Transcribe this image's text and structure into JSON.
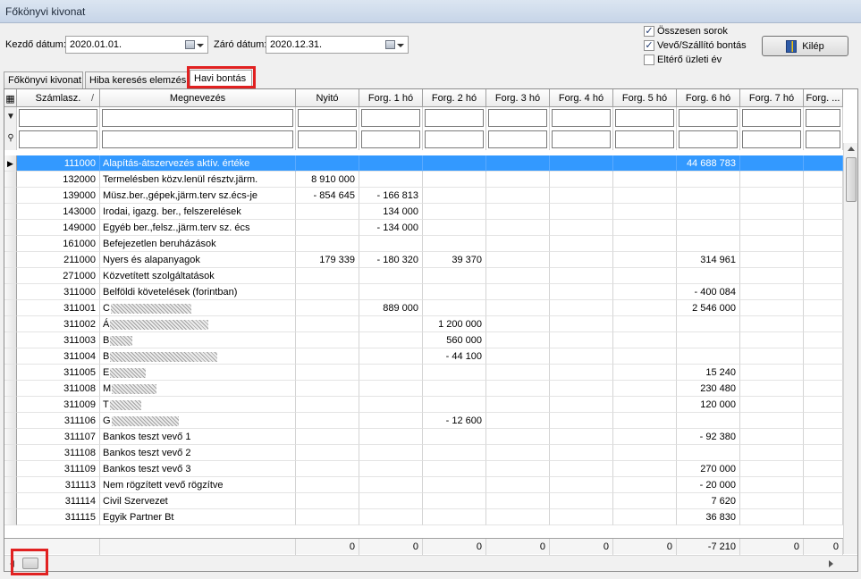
{
  "window": {
    "title": "Főkönyvi kivonat"
  },
  "filters": {
    "start_label": "Kezdő dátum:",
    "start_value": "2020.01.01.",
    "end_label": "Záró dátum:",
    "end_value": "2020.12.31."
  },
  "options": {
    "total_rows": {
      "label": "Összesen sorok",
      "checked": true
    },
    "partner_split": {
      "label": "Vevő/Szállító bontás",
      "checked": true
    },
    "diff_year": {
      "label": "Eltérő üzleti év",
      "checked": false
    }
  },
  "exit_button": {
    "label": "Kilép",
    "icon": "door-exit-icon"
  },
  "tabs": [
    {
      "label": "Főkönyvi kivonat",
      "active": false
    },
    {
      "label": "Hiba keresés elemzés",
      "active": false
    },
    {
      "label": "Havi bontás",
      "active": true
    }
  ],
  "columns": [
    "Számlasz.",
    "Megnevezés",
    "Nyitó",
    "Forg. 1 hó",
    "Forg. 2 hó",
    "Forg. 3 hó",
    "Forg. 4 hó",
    "Forg. 5 hó",
    "Forg. 6 hó",
    "Forg. 7 hó",
    "Forg. ..."
  ],
  "sort_indicator": "/",
  "rows": [
    {
      "acc": "111000",
      "name": "Alapítás-átszervezés aktív. értéke",
      "v": [
        "",
        "",
        "",
        "",
        "",
        "",
        "44 688 783",
        "",
        ""
      ],
      "selected": true
    },
    {
      "acc": "132000",
      "name": "Termelésben közv.lenül résztv.järm.",
      "v": [
        "8 910 000",
        "",
        "",
        "",
        "",
        "",
        "",
        "",
        ""
      ]
    },
    {
      "acc": "139000",
      "name": "Müsz.ber.,gépek,järm.terv sz.écs-je",
      "v": [
        "- 854 645",
        "- 166 813",
        "",
        "",
        "",
        "",
        "",
        "",
        ""
      ]
    },
    {
      "acc": "143000",
      "name": "Irodai, igazg. ber., felszerelések",
      "v": [
        "",
        "134 000",
        "",
        "",
        "",
        "",
        "",
        "",
        ""
      ]
    },
    {
      "acc": "149000",
      "name": "Egyéb ber.,felsz.,järm.terv sz. écs",
      "v": [
        "",
        "- 134 000",
        "",
        "",
        "",
        "",
        "",
        "",
        ""
      ]
    },
    {
      "acc": "161000",
      "name": "Befejezetlen beruházások",
      "v": [
        "",
        "",
        "",
        "",
        "",
        "",
        "",
        "",
        ""
      ]
    },
    {
      "acc": "211000",
      "name": "Nyers és alapanyagok",
      "v": [
        "179 339",
        "- 180 320",
        "39 370",
        "",
        "",
        "",
        "314 961",
        "",
        ""
      ]
    },
    {
      "acc": "271000",
      "name": "Közvetített szolgáltatások",
      "v": [
        "",
        "",
        "",
        "",
        "",
        "",
        "",
        "",
        ""
      ]
    },
    {
      "acc": "311000",
      "name": "Belföldi követelések (forintban)",
      "v": [
        "",
        "",
        "",
        "",
        "",
        "",
        "- 400 084",
        "",
        ""
      ]
    },
    {
      "acc": "311001",
      "name": "C",
      "blur": 90,
      "v": [
        "",
        "889 000",
        "",
        "",
        "",
        "",
        "2 546 000",
        "",
        ""
      ]
    },
    {
      "acc": "311002",
      "name": "Á",
      "blur": 110,
      "v": [
        "",
        "",
        "1 200 000",
        "",
        "",
        "",
        "",
        "",
        ""
      ]
    },
    {
      "acc": "311003",
      "name": "B",
      "blur": 25,
      "v": [
        "",
        "",
        "560 000",
        "",
        "",
        "",
        "",
        "",
        ""
      ]
    },
    {
      "acc": "311004",
      "name": "B",
      "blur": 120,
      "v": [
        "",
        "",
        "- 44 100",
        "",
        "",
        "",
        "",
        "",
        ""
      ]
    },
    {
      "acc": "311005",
      "name": "E",
      "blur": 40,
      "v": [
        "",
        "",
        "",
        "",
        "",
        "",
        "15 240",
        "",
        ""
      ]
    },
    {
      "acc": "311008",
      "name": "M",
      "blur": 50,
      "v": [
        "",
        "",
        "",
        "",
        "",
        "",
        "230 480",
        "",
        ""
      ]
    },
    {
      "acc": "311009",
      "name": "T",
      "blur": 35,
      "v": [
        "",
        "",
        "",
        "",
        "",
        "",
        "120 000",
        "",
        ""
      ]
    },
    {
      "acc": "311106",
      "name": "G",
      "blur": 75,
      "v": [
        "",
        "",
        "- 12 600",
        "",
        "",
        "",
        "",
        "",
        ""
      ]
    },
    {
      "acc": "311107",
      "name": "Bankos teszt vevő 1",
      "v": [
        "",
        "",
        "",
        "",
        "",
        "",
        "- 92 380",
        "",
        ""
      ]
    },
    {
      "acc": "311108",
      "name": "Bankos teszt vevő 2",
      "v": [
        "",
        "",
        "",
        "",
        "",
        "",
        "",
        "",
        ""
      ]
    },
    {
      "acc": "311109",
      "name": "Bankos teszt vevő 3",
      "v": [
        "",
        "",
        "",
        "",
        "",
        "",
        "270 000",
        "",
        ""
      ]
    },
    {
      "acc": "311113",
      "name": "Nem rögzített vevő rögzítve",
      "v": [
        "",
        "",
        "",
        "",
        "",
        "",
        "- 20 000",
        "",
        ""
      ]
    },
    {
      "acc": "311114",
      "name": "Civil Szervezet",
      "v": [
        "",
        "",
        "",
        "",
        "",
        "",
        "7 620",
        "",
        ""
      ]
    },
    {
      "acc": "311115",
      "name": "Egyik Partner Bt",
      "v": [
        "",
        "",
        "",
        "",
        "",
        "",
        "36 830",
        "",
        ""
      ]
    }
  ],
  "totals": [
    "0",
    "0",
    "0",
    "0",
    "0",
    "0",
    "-7 210",
    "0",
    "0"
  ],
  "icons": {
    "grid_menu": "grid-config-icon",
    "filter_row": "filter-icon",
    "search_row": "binoculars-icon",
    "current_row": "row-pointer-icon"
  }
}
